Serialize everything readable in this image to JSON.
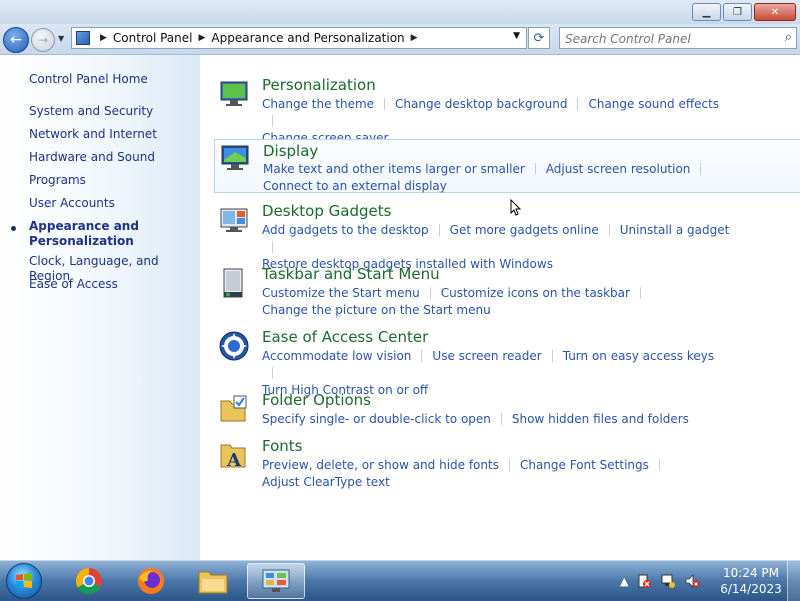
{
  "window": {
    "minimize": "▁",
    "maximize": "❐",
    "close": "✕"
  },
  "nav": {
    "back_icon": "←",
    "forward_icon": "→",
    "breadcrumb": [
      "Control Panel",
      "Appearance and Personalization"
    ],
    "search_placeholder": "Search Control Panel"
  },
  "sidebar": {
    "home": "Control Panel Home",
    "items": [
      {
        "label": "System and Security"
      },
      {
        "label": "Network and Internet"
      },
      {
        "label": "Hardware and Sound"
      },
      {
        "label": "Programs"
      },
      {
        "label": "User Accounts"
      },
      {
        "label": "Appearance and Personalization",
        "line2": "Personalization",
        "line1": "Appearance and",
        "active": true
      },
      {
        "label": "Clock, Language, and Region"
      },
      {
        "label": "Ease of Access"
      }
    ]
  },
  "categories": [
    {
      "title": "Personalization",
      "icon": "personalization-icon",
      "links": [
        "Change the theme",
        "Change desktop background",
        "Change sound effects",
        "Change screen saver"
      ]
    },
    {
      "title": "Display",
      "icon": "display-icon",
      "highlighted": true,
      "links": [
        "Make text and other items larger or smaller",
        "Adjust screen resolution",
        "Connect to an external display"
      ]
    },
    {
      "title": "Desktop Gadgets",
      "icon": "gadgets-icon",
      "links": [
        "Add gadgets to the desktop",
        "Get more gadgets online",
        "Uninstall a gadget",
        "Restore desktop gadgets installed with Windows"
      ]
    },
    {
      "title": "Taskbar and Start Menu",
      "icon": "taskbar-icon",
      "links": [
        "Customize the Start menu",
        "Customize icons on the taskbar",
        "Change the picture on the Start menu"
      ]
    },
    {
      "title": "Ease of Access Center",
      "icon": "ease-of-access-icon",
      "links": [
        "Accommodate low vision",
        "Use screen reader",
        "Turn on easy access keys",
        "Turn High Contrast on or off"
      ]
    },
    {
      "title": "Folder Options",
      "icon": "folder-options-icon",
      "links": [
        "Specify single- or double-click to open",
        "Show hidden files and folders"
      ]
    },
    {
      "title": "Fonts",
      "icon": "fonts-icon",
      "links": [
        "Preview, delete, or show and hide fonts",
        "Change Font Settings",
        "Adjust ClearType text"
      ]
    }
  ],
  "taskbar": {
    "apps": [
      "chrome-icon",
      "firefox-icon",
      "file-explorer-icon",
      "control-panel-icon"
    ],
    "time": "10:24 PM",
    "date": "6/14/2023"
  }
}
